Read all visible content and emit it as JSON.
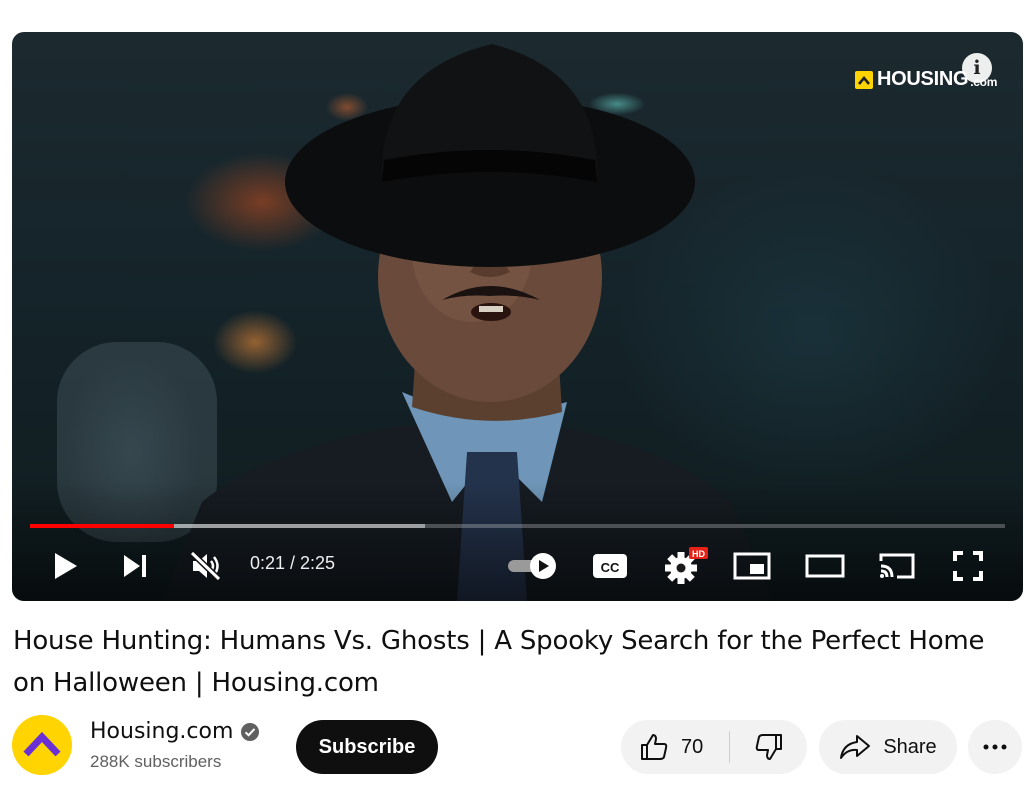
{
  "player": {
    "brand_text": "HOUSING",
    "brand_suffix": ".com",
    "time_display": "0:21 / 2:25",
    "played_fraction": 0.148,
    "buffered_fraction": 0.405,
    "autoplay_on": true,
    "colors": {
      "progress": "#ff0000",
      "hd_badge": "#e62117",
      "brand_yellow": "#ffd400"
    },
    "icons": [
      "play-icon",
      "next-icon",
      "mute-icon",
      "autoplay-toggle-icon",
      "captions-icon",
      "settings-icon",
      "miniplayer-icon",
      "theater-icon",
      "cast-icon",
      "fullscreen-icon",
      "info-icon"
    ],
    "hd_badge": "HD",
    "cc_label": "CC",
    "info_label": "i"
  },
  "video": {
    "title": "House Hunting: Humans Vs. Ghosts | A Spooky Search for the Perfect Home on Halloween | Housing.com"
  },
  "channel": {
    "name": "Housing.com",
    "verified": true,
    "subscribers": "288K subscribers",
    "subscribe_label": "Subscribe"
  },
  "actions": {
    "like_count": "70",
    "share_label": "Share",
    "more_label": "•••"
  }
}
